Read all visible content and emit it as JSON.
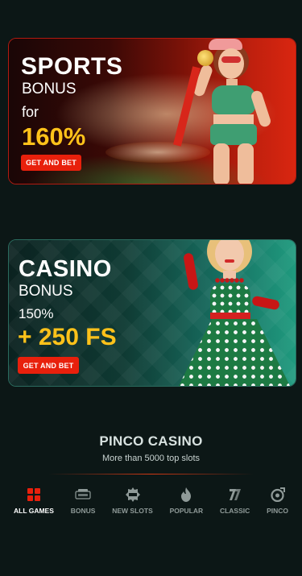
{
  "colors": {
    "background": "#0c1716",
    "accent": "#e8200c",
    "highlight": "#ffc21a",
    "inactive_tab": "#8f9a98"
  },
  "banners": [
    {
      "title": "SPORTS",
      "line1": "BONUS",
      "line2": "for",
      "amount": "160%",
      "cta": "GET AND BET"
    },
    {
      "title": "CASINO",
      "line1": "BONUS",
      "line2": "150%",
      "amount": "+ 250 FS",
      "cta": "GET AND BET"
    }
  ],
  "section": {
    "title": "PINCO CASINO",
    "subtitle": "More than 5000 top slots"
  },
  "tabs": [
    {
      "label": "ALL GAMES",
      "icon": "grid-icon",
      "active": true
    },
    {
      "label": "BONUS",
      "icon": "bonus-icon",
      "active": false
    },
    {
      "label": "NEW SLOTS",
      "icon": "new-badge-icon",
      "active": false
    },
    {
      "label": "POPULAR",
      "icon": "fire-icon",
      "active": false
    },
    {
      "label": "CLASSIC",
      "icon": "seven-icon",
      "active": false
    },
    {
      "label": "PINCO",
      "icon": "pinco-icon",
      "active": false
    }
  ]
}
